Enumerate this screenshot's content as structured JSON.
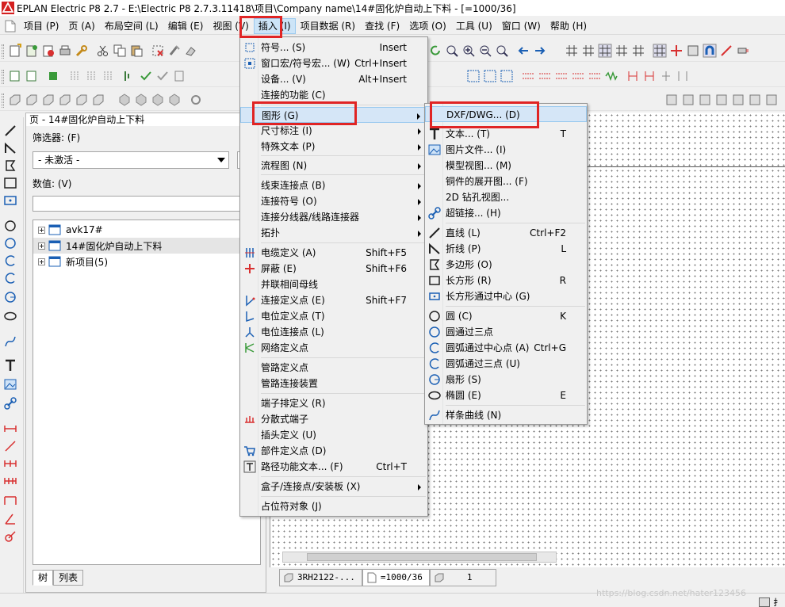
{
  "window": {
    "title": "EPLAN Electric P8 2.7 - E:\\Electric P8 2.7.3.11418\\项目\\Company name\\14#固化炉自动上下料 - [=1000/36]"
  },
  "menubar": {
    "items": [
      {
        "label": "项目 (P)"
      },
      {
        "label": "页 (A)"
      },
      {
        "label": "布局空间 (L)"
      },
      {
        "label": "编辑 (E)"
      },
      {
        "label": "视图 (V)"
      },
      {
        "label": "插入 (I)"
      },
      {
        "label": "项目数据 (R)"
      },
      {
        "label": "查找 (F)"
      },
      {
        "label": "选项 (O)"
      },
      {
        "label": "工具 (U)"
      },
      {
        "label": "窗口 (W)"
      },
      {
        "label": "帮助 (H)"
      }
    ]
  },
  "navigator": {
    "title": "页 - 14#固化炉自动上下料",
    "filter_label": "筛选器: (F)",
    "filter_value": "- 未激活 -",
    "value_label": "数值: (V)",
    "tree": [
      {
        "label": "avk17#"
      },
      {
        "label": "14#固化炉自动上下料"
      },
      {
        "label": "新项目(5)"
      }
    ],
    "tabs": [
      {
        "label": "树"
      },
      {
        "label": "列表"
      }
    ]
  },
  "insert_menu": {
    "items": [
      {
        "label": "符号... (S)",
        "shortcut": "Insert"
      },
      {
        "label": "窗口宏/符号宏... (W)",
        "shortcut": "Ctrl+Insert"
      },
      {
        "label": "设备... (V)",
        "shortcut": "Alt+Insert"
      },
      {
        "label": "连接的功能 (C)",
        "shortcut": ""
      },
      {
        "label": "图形 (G)",
        "shortcut": ""
      },
      {
        "label": "尺寸标注 (I)",
        "shortcut": ""
      },
      {
        "label": "特殊文本 (P)",
        "shortcut": ""
      },
      {
        "label": "流程图 (N)",
        "shortcut": ""
      },
      {
        "label": "线束连接点 (B)",
        "shortcut": ""
      },
      {
        "label": "连接符号 (O)",
        "shortcut": ""
      },
      {
        "label": "连接分线器/线路连接器",
        "shortcut": ""
      },
      {
        "label": "拓扑",
        "shortcut": ""
      },
      {
        "label": "电缆定义 (A)",
        "shortcut": "Shift+F5"
      },
      {
        "label": "屏蔽 (E)",
        "shortcut": "Shift+F6"
      },
      {
        "label": "并联相间母线",
        "shortcut": ""
      },
      {
        "label": "连接定义点 (E)",
        "shortcut": "Shift+F7"
      },
      {
        "label": "电位定义点 (T)",
        "shortcut": ""
      },
      {
        "label": "电位连接点 (L)",
        "shortcut": ""
      },
      {
        "label": "网络定义点",
        "shortcut": ""
      },
      {
        "label": "管路定义点",
        "shortcut": ""
      },
      {
        "label": "管路连接装置",
        "shortcut": ""
      },
      {
        "label": "端子排定义 (R)",
        "shortcut": ""
      },
      {
        "label": "分散式端子",
        "shortcut": ""
      },
      {
        "label": "插头定义 (U)",
        "shortcut": ""
      },
      {
        "label": "部件定义点 (D)",
        "shortcut": ""
      },
      {
        "label": "路径功能文本... (F)",
        "shortcut": "Ctrl+T"
      },
      {
        "label": "盒子/连接点/安装板 (X)",
        "shortcut": ""
      },
      {
        "label": "占位符对象 (J)",
        "shortcut": ""
      }
    ]
  },
  "graphics_menu": {
    "items": [
      {
        "label": "DXF/DWG... (D)",
        "shortcut": ""
      },
      {
        "label": "文本... (T)",
        "shortcut": "T"
      },
      {
        "label": "图片文件... (I)",
        "shortcut": ""
      },
      {
        "label": "模型视图... (M)",
        "shortcut": ""
      },
      {
        "label": "铜件的展开图... (F)",
        "shortcut": ""
      },
      {
        "label": "2D 钻孔视图...",
        "shortcut": ""
      },
      {
        "label": "超链接... (H)",
        "shortcut": ""
      },
      {
        "label": "直线 (L)",
        "shortcut": "Ctrl+F2"
      },
      {
        "label": "折线 (P)",
        "shortcut": "L"
      },
      {
        "label": "多边形 (O)",
        "shortcut": ""
      },
      {
        "label": "长方形 (R)",
        "shortcut": "R"
      },
      {
        "label": "长方形通过中心 (G)",
        "shortcut": ""
      },
      {
        "label": "圆 (C)",
        "shortcut": "K"
      },
      {
        "label": "圆通过三点",
        "shortcut": ""
      },
      {
        "label": "圆弧通过中心点 (A)",
        "shortcut": "Ctrl+G"
      },
      {
        "label": "圆弧通过三点 (U)",
        "shortcut": ""
      },
      {
        "label": "扇形 (S)",
        "shortcut": ""
      },
      {
        "label": "椭圆 (E)",
        "shortcut": "E"
      },
      {
        "label": "样条曲线 (N)",
        "shortcut": ""
      }
    ]
  },
  "page_tabs": [
    {
      "label": "3RH2122-..."
    },
    {
      "label": "=1000/36"
    },
    {
      "label": "1"
    }
  ],
  "statusbar": {
    "watermark": "https://blog.csdn.net/hater123456",
    "right_text": "扌"
  },
  "colors": {
    "highlight": "#e02424",
    "menu_hover": "#d5e6f7",
    "logo": "#d42020"
  }
}
